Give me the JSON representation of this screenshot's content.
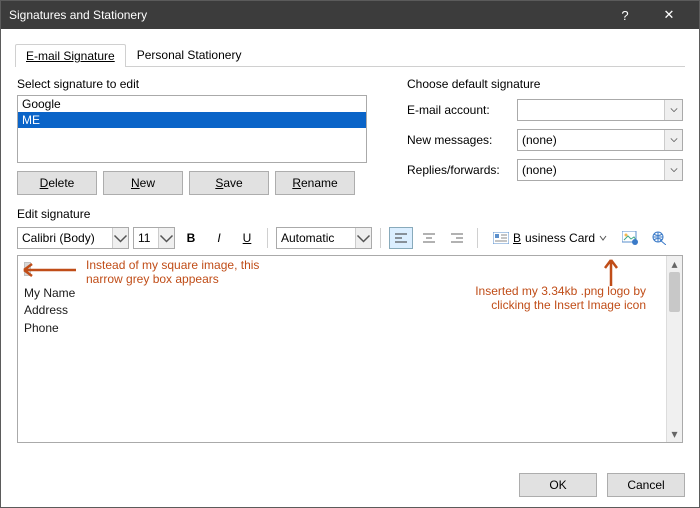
{
  "titlebar": {
    "title": "Signatures and Stationery",
    "help": "?",
    "close": "✕"
  },
  "tabs": {
    "a": "E-mail Signature",
    "b": "Personal Stationery"
  },
  "left": {
    "legend": "Select signature to edit",
    "items": {
      "0": "Google",
      "1": "ME"
    },
    "buttons": {
      "del": "Delete",
      "new": "New",
      "save": "Save",
      "ren": "Rename"
    }
  },
  "right": {
    "legend": "Choose default signature",
    "acct_label": "E-mail account:",
    "acct_value": " ",
    "newmsg_label": "New messages:",
    "newmsg_value": "(none)",
    "repl_label": "Replies/forwards:",
    "repl_value": "(none)"
  },
  "edit": {
    "legend": "Edit signature",
    "font": "Calibri (Body)",
    "size": "11",
    "color": "Automatic",
    "biz": "Business Card",
    "lines": {
      "0": "My Name",
      "1": "Address",
      "2": "Phone"
    }
  },
  "annot": {
    "left1": "Instead of my square image, this",
    "left2": "narrow grey box appears",
    "right1": "Inserted my 3.34kb .png logo by",
    "right2": "clicking the Insert Image icon"
  },
  "dlg": {
    "ok": "OK",
    "cancel": "Cancel"
  }
}
